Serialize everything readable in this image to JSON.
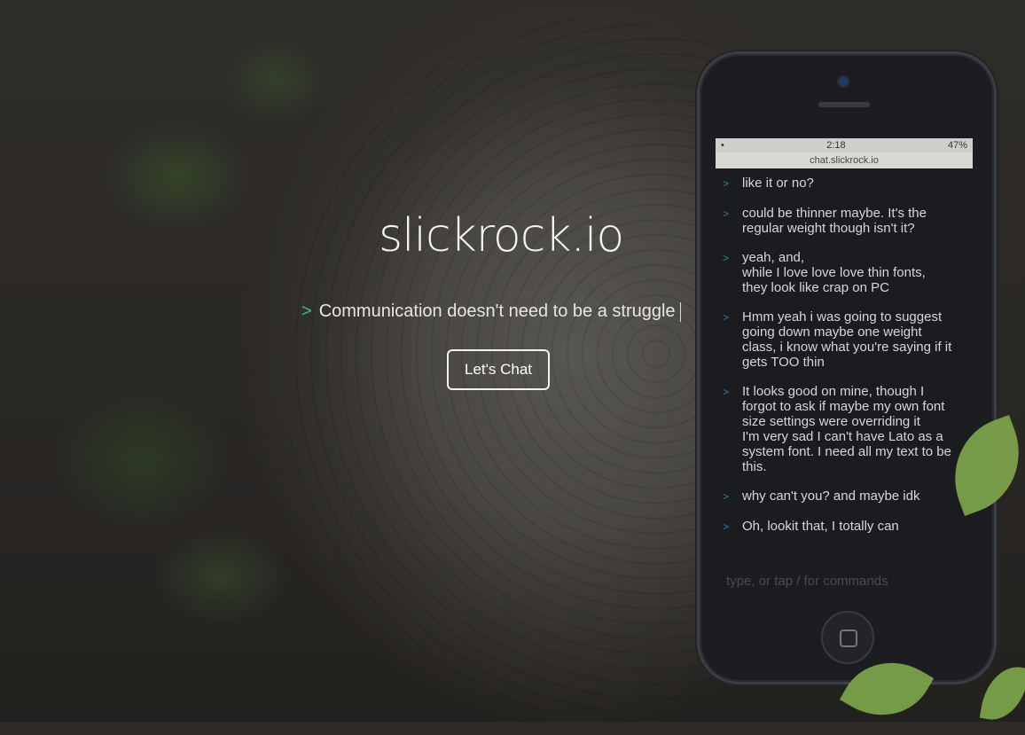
{
  "hero": {
    "brand": "slickrock.io",
    "prompt_symbol": ">",
    "tagline": "Communication doesn't need to be a struggle",
    "cta_label": "Let's Chat"
  },
  "phone": {
    "status_time": "2:18",
    "status_battery": "47%",
    "url": "chat.slickrock.io",
    "messages": [
      {
        "lines": [
          "like it or no?"
        ],
        "color": "green"
      },
      {
        "lines": [
          "could be thinner maybe. It's the",
          "regular weight though isn't it?"
        ],
        "color": "blue"
      },
      {
        "lines": [
          "yeah, and,",
          "while I love love love thin fonts,",
          "they look like crap on PC"
        ],
        "color": "green"
      },
      {
        "lines": [
          "Hmm yeah i was going to suggest",
          "going down maybe one weight",
          "class, i know what you're saying if it",
          "gets TOO thin"
        ],
        "color": "blue"
      },
      {
        "lines": [
          "It looks good on mine, though I",
          "forgot to ask if maybe my own font",
          "size settings were overriding it",
          "I'm very sad I can't have Lato as a",
          "system font. I need all my text to be",
          "this."
        ],
        "color": "blue"
      },
      {
        "lines": [
          "why can't you? and maybe idk"
        ],
        "color": "green"
      },
      {
        "lines": [
          "Oh, lookit that, I totally can"
        ],
        "color": "blue"
      }
    ],
    "input_placeholder": "type, or tap / for commands"
  },
  "colors": {
    "accent_green": "#3cc27a",
    "text_light": "#f2f2f2"
  }
}
